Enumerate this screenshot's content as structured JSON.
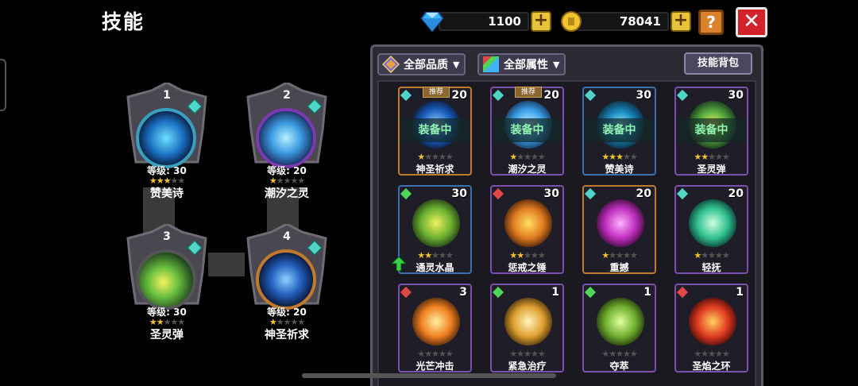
{
  "header": {
    "title": "技能",
    "gems": "1100",
    "gold": "78041",
    "plus_label": "+",
    "help_label": "?",
    "close_label": "✕"
  },
  "equipped": [
    {
      "slot": "1",
      "level": "等级: 30",
      "name": "赞美诗",
      "stars": 3
    },
    {
      "slot": "2",
      "level": "等级: 20",
      "name": "潮汐之灵",
      "stars": 1
    },
    {
      "slot": "3",
      "level": "等级: 30",
      "name": "圣灵弹",
      "stars": 2
    },
    {
      "slot": "4",
      "level": "等级: 20",
      "name": "神圣祈求",
      "stars": 1
    }
  ],
  "panel": {
    "filter_quality": "全部品质",
    "filter_attribute": "全部属性",
    "bag_button": "技能背包",
    "equipped_label": "装备中",
    "recommend_label": "推荐"
  },
  "skills": [
    {
      "name": "神圣祈求",
      "level": "20",
      "stars": 1,
      "equipped": true,
      "recommended": true,
      "rarity": "orange",
      "gem": "#4fd6c8"
    },
    {
      "name": "潮汐之灵",
      "level": "20",
      "stars": 1,
      "equipped": true,
      "recommended": true,
      "rarity": "purple",
      "gem": "#4fd6c8"
    },
    {
      "name": "赞美诗",
      "level": "30",
      "stars": 3,
      "equipped": true,
      "recommended": false,
      "rarity": "blue",
      "gem": "#4fd6c8"
    },
    {
      "name": "圣灵弹",
      "level": "30",
      "stars": 2,
      "equipped": true,
      "recommended": false,
      "rarity": "purple",
      "gem": "#4fd6c8"
    },
    {
      "name": "通灵水晶",
      "level": "30",
      "stars": 2,
      "equipped": false,
      "recommended": false,
      "rarity": "blue",
      "gem": "#4fd65a",
      "upgrade": true
    },
    {
      "name": "惩戒之锤",
      "level": "30",
      "stars": 2,
      "equipped": false,
      "recommended": false,
      "rarity": "purple",
      "gem": "#e04848"
    },
    {
      "name": "重撼",
      "level": "20",
      "stars": 1,
      "equipped": false,
      "recommended": false,
      "rarity": "orange",
      "gem": "#4fd6c8"
    },
    {
      "name": "轻抚",
      "level": "20",
      "stars": 1,
      "equipped": false,
      "recommended": false,
      "rarity": "purple",
      "gem": "#4fd6c8"
    },
    {
      "name": "光芒冲击",
      "level": "3",
      "stars": 0,
      "equipped": false,
      "recommended": false,
      "rarity": "purple",
      "gem": "#e04848"
    },
    {
      "name": "紧急治疗",
      "level": "1",
      "stars": 0,
      "equipped": false,
      "recommended": false,
      "rarity": "purple",
      "gem": "#4fd65a"
    },
    {
      "name": "夺萃",
      "level": "1",
      "stars": 0,
      "equipped": false,
      "recommended": false,
      "rarity": "purple",
      "gem": "#4fd65a"
    },
    {
      "name": "圣焰之环",
      "level": "1",
      "stars": 0,
      "equipped": false,
      "recommended": false,
      "rarity": "purple",
      "gem": "#e04848"
    }
  ],
  "icons": [
    "gem-icon",
    "coin-icon",
    "help-icon",
    "close-icon",
    "quality-filter-icon",
    "attribute-filter-icon",
    "upgrade-arrow-icon"
  ],
  "colors": {
    "accent_gold": "#e8c43a",
    "close_red": "#d2232a",
    "equipped_text": "#8ff5b0",
    "star": "#f2c330"
  }
}
